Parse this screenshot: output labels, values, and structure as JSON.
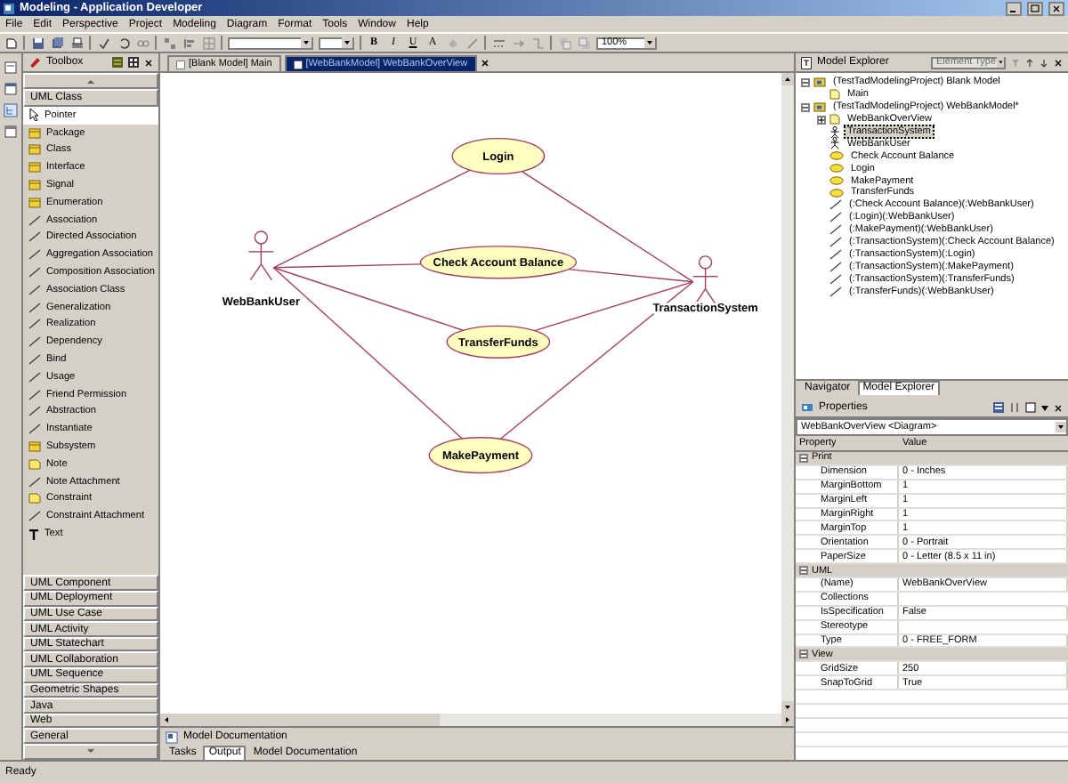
{
  "window": {
    "title": "Modeling - Application Developer"
  },
  "menu": [
    "File",
    "Edit",
    "Perspective",
    "Project",
    "Modeling",
    "Diagram",
    "Format",
    "Tools",
    "Window",
    "Help"
  ],
  "toolbar": {
    "format_buttons": [
      "B",
      "I",
      "U",
      "A"
    ],
    "zoom": "100%"
  },
  "toolbox": {
    "title": "Toolbox",
    "group": "UML Class",
    "items": [
      {
        "label": "Pointer",
        "kind": "pointer",
        "selected": true
      },
      {
        "label": "Package",
        "kind": "shape",
        "selected": false
      },
      {
        "label": "Class",
        "kind": "shape",
        "selected": false
      },
      {
        "label": "Interface",
        "kind": "shape",
        "selected": false
      },
      {
        "label": "Signal",
        "kind": "shape",
        "selected": false
      },
      {
        "label": "Enumeration",
        "kind": "shape",
        "selected": false
      },
      {
        "label": "Association",
        "kind": "line",
        "selected": false
      },
      {
        "label": "Directed Association",
        "kind": "line",
        "selected": false
      },
      {
        "label": "Aggregation Association",
        "kind": "line",
        "selected": false
      },
      {
        "label": "Composition Association",
        "kind": "line",
        "selected": false
      },
      {
        "label": "Association Class",
        "kind": "line",
        "selected": false
      },
      {
        "label": "Generalization",
        "kind": "line",
        "selected": false
      },
      {
        "label": "Realization",
        "kind": "line",
        "selected": false
      },
      {
        "label": "Dependency",
        "kind": "line",
        "selected": false
      },
      {
        "label": "Bind",
        "kind": "line",
        "selected": false
      },
      {
        "label": "Usage",
        "kind": "line",
        "selected": false
      },
      {
        "label": "Friend Permission",
        "kind": "line",
        "selected": false
      },
      {
        "label": "Abstraction",
        "kind": "line",
        "selected": false
      },
      {
        "label": "Instantiate",
        "kind": "line",
        "selected": false
      },
      {
        "label": "Subsystem",
        "kind": "shape",
        "selected": false
      },
      {
        "label": "Note",
        "kind": "note",
        "selected": false
      },
      {
        "label": "Note Attachment",
        "kind": "line",
        "selected": false
      },
      {
        "label": "Constraint",
        "kind": "note",
        "selected": false
      },
      {
        "label": "Constraint Attachment",
        "kind": "line",
        "selected": false
      },
      {
        "label": "Text",
        "kind": "text",
        "selected": false
      }
    ],
    "categories": [
      "UML Component",
      "UML Deployment",
      "UML Use Case",
      "UML Activity",
      "UML Statechart",
      "UML Collaboration",
      "UML Sequence",
      "Geometric Shapes",
      "Java",
      "Web",
      "General"
    ]
  },
  "editor": {
    "tabs": [
      {
        "label": "[Blank Model] Main",
        "selected": false
      },
      {
        "label": "[WebBankModel] WebBankOverView",
        "selected": true
      }
    ],
    "diagram": {
      "actors": [
        {
          "name": "WebBankUser"
        },
        {
          "name": "TransactionSystem"
        }
      ],
      "use_cases": [
        {
          "name": "Login"
        },
        {
          "name": "Check Account Balance"
        },
        {
          "name": "TransferFunds"
        },
        {
          "name": "MakePayment"
        }
      ]
    }
  },
  "documentation": {
    "title": "Model Documentation"
  },
  "bottom_tabs": [
    {
      "label": "Tasks",
      "selected": false
    },
    {
      "label": "Output",
      "selected": true
    },
    {
      "label": "Model Documentation",
      "selected": false
    }
  ],
  "explorer": {
    "title": "Model Explorer",
    "filter": {
      "value": "Element Type",
      "disabled": true
    },
    "tree": [
      {
        "label": "(TestTadModelingProject) Blank Model",
        "kind": "model",
        "expanded": true,
        "selected": false,
        "children": [
          {
            "label": "Main",
            "kind": "diagram",
            "selected": false
          }
        ]
      },
      {
        "label": "(TestTadModelingProject) WebBankModel*",
        "kind": "model",
        "expanded": true,
        "selected": false,
        "children": [
          {
            "label": "WebBankOverView",
            "kind": "diagram",
            "expanded": false,
            "selected": false
          },
          {
            "label": "TransactionSystem",
            "kind": "actor",
            "selected": true
          },
          {
            "label": "WebBankUser",
            "kind": "actor",
            "selected": false
          },
          {
            "label": "Check Account Balance",
            "kind": "usecase",
            "selected": false
          },
          {
            "label": "Login",
            "kind": "usecase",
            "selected": false
          },
          {
            "label": "MakePayment",
            "kind": "usecase",
            "selected": false
          },
          {
            "label": "TransferFunds",
            "kind": "usecase",
            "selected": false
          },
          {
            "label": "(:Check Account Balance)(:WebBankUser)",
            "kind": "association",
            "selected": false
          },
          {
            "label": "(:Login)(:WebBankUser)",
            "kind": "association",
            "selected": false
          },
          {
            "label": "(:MakePayment)(:WebBankUser)",
            "kind": "association",
            "selected": false
          },
          {
            "label": "(:TransactionSystem)(:Check Account Balance)",
            "kind": "association",
            "selected": false
          },
          {
            "label": "(:TransactionSystem)(:Login)",
            "kind": "association",
            "selected": false
          },
          {
            "label": "(:TransactionSystem)(:MakePayment)",
            "kind": "association",
            "selected": false
          },
          {
            "label": "(:TransactionSystem)(:TransferFunds)",
            "kind": "association",
            "selected": false
          },
          {
            "label": "(:TransferFunds)(:WebBankUser)",
            "kind": "association",
            "selected": false
          }
        ]
      }
    ]
  },
  "explorer_tabs": [
    {
      "label": "Navigator",
      "selected": false
    },
    {
      "label": "Model Explorer",
      "selected": true
    }
  ],
  "properties": {
    "title": "Properties",
    "selector": "WebBankOverView <Diagram>",
    "columns": [
      "Property",
      "Value"
    ],
    "groups": [
      {
        "name": "Print",
        "expanded": true,
        "rows": [
          {
            "name": "Dimension",
            "value": "0 - Inches"
          },
          {
            "name": "MarginBottom",
            "value": "1"
          },
          {
            "name": "MarginLeft",
            "value": "1"
          },
          {
            "name": "MarginRight",
            "value": "1"
          },
          {
            "name": "MarginTop",
            "value": "1"
          },
          {
            "name": "Orientation",
            "value": "0 - Portrait"
          },
          {
            "name": "PaperSize",
            "value": "0 - Letter (8.5 x 11 in)"
          }
        ]
      },
      {
        "name": "UML",
        "expanded": true,
        "rows": [
          {
            "name": "(Name)",
            "value": "WebBankOverView"
          },
          {
            "name": "Collections",
            "value": ""
          },
          {
            "name": "IsSpecification",
            "value": "False"
          },
          {
            "name": "Stereotype",
            "value": ""
          },
          {
            "name": "Type",
            "value": "0 - FREE_FORM"
          }
        ]
      },
      {
        "name": "View",
        "expanded": true,
        "rows": [
          {
            "name": "GridSize",
            "value": "250"
          },
          {
            "name": "SnapToGrid",
            "value": "True"
          }
        ]
      }
    ]
  },
  "status_bar": "Ready"
}
